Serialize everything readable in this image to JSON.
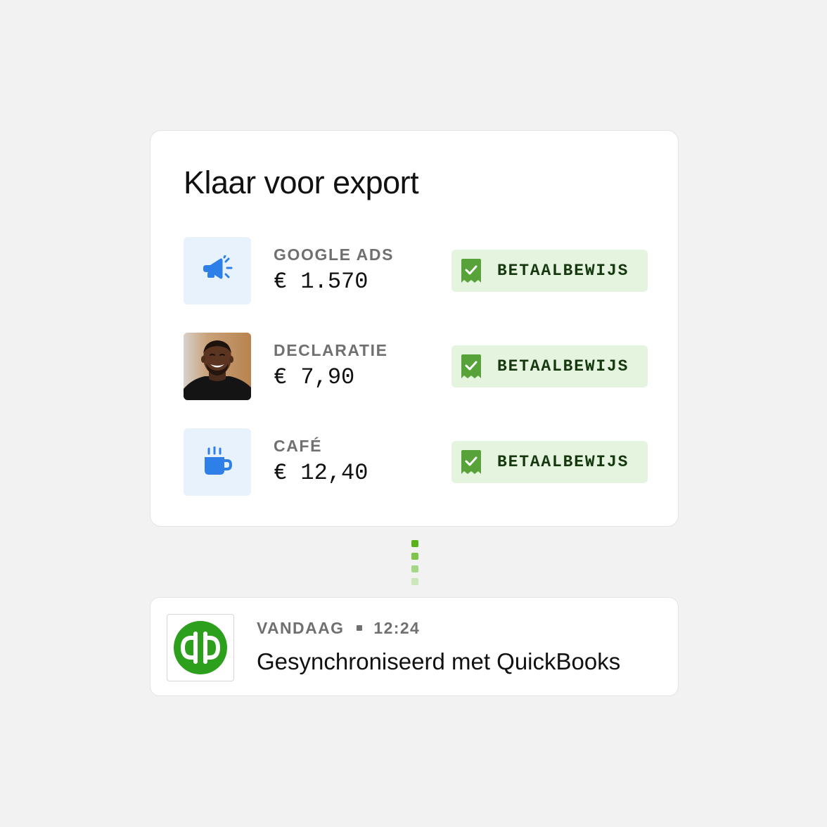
{
  "export_card": {
    "title": "Klaar voor export",
    "items": [
      {
        "label": "GOOGLE ADS",
        "amount": "€ 1.570",
        "icon": "megaphone-icon",
        "status": "BETAALBEWIJS"
      },
      {
        "label": "DECLARATIE",
        "amount": "€ 7,90",
        "icon": "person-photo",
        "status": "BETAALBEWIJS"
      },
      {
        "label": "CAFÉ",
        "amount": "€ 12,40",
        "icon": "coffee-cup-icon",
        "status": "BETAALBEWIJS"
      }
    ]
  },
  "sync_card": {
    "logo": "quickbooks-logo",
    "day": "VANDAAG",
    "time": "12:24",
    "message": "Gesynchroniseerd met QuickBooks"
  },
  "colors": {
    "background": "#f2f2f2",
    "accent_blue": "#2f7fe8",
    "icon_tile": "#e8f2fd",
    "badge_bg": "#e4f4de",
    "badge_icon": "#58a339",
    "badge_text": "#16380f",
    "quickbooks_green": "#2ca01c",
    "connector": [
      "#5bb217",
      "#7ec54a",
      "#a4d884",
      "#cbe8b9"
    ]
  }
}
